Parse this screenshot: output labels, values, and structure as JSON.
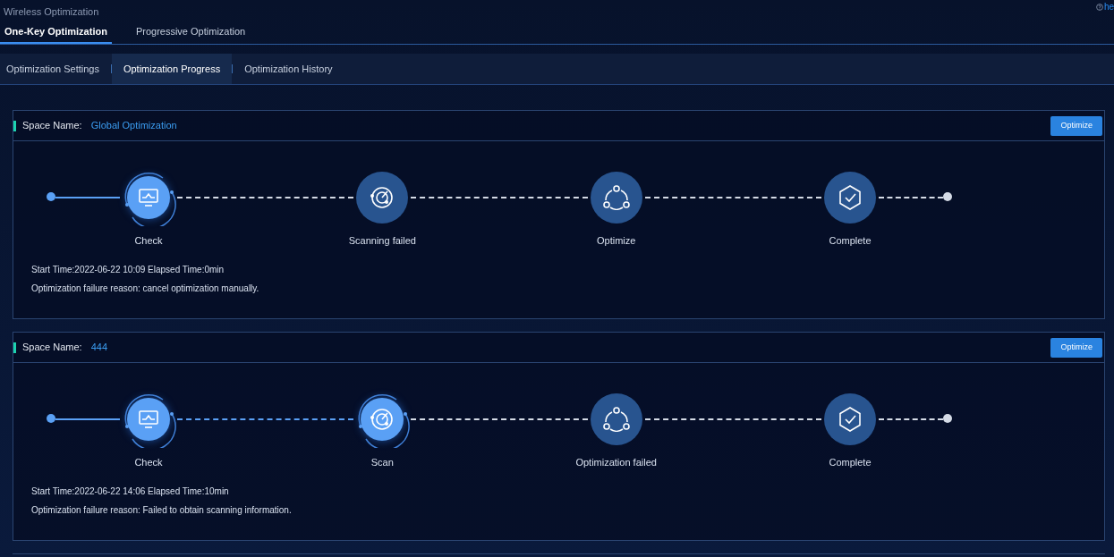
{
  "header": {
    "title": "Wireless Optimization",
    "help_link": "he"
  },
  "tabs": [
    {
      "label": "One-Key Optimization",
      "selected": true
    },
    {
      "label": "Progressive Optimization",
      "selected": false
    }
  ],
  "subtabs": [
    {
      "label": "Optimization Settings",
      "selected": false
    },
    {
      "label": "Optimization Progress",
      "selected": true
    },
    {
      "label": "Optimization History",
      "selected": false
    }
  ],
  "cards": [
    {
      "space_label": "Space Name:",
      "space_name": "Global Optimization",
      "button": "Optimize",
      "steps": [
        {
          "kind": "check",
          "label": "Check",
          "done": true
        },
        {
          "kind": "scan",
          "label": "Scanning failed",
          "done": false
        },
        {
          "kind": "optimize",
          "label": "Optimize",
          "done": false
        },
        {
          "kind": "complete",
          "label": "Complete",
          "done": false
        }
      ],
      "start_info": "Start Time:2022-06-22 10:09 Elapsed Time:0min",
      "failure_reason": "Optimization failure reason: cancel optimization manually."
    },
    {
      "space_label": "Space Name:",
      "space_name": "444",
      "button": "Optimize",
      "steps": [
        {
          "kind": "check",
          "label": "Check",
          "done": true
        },
        {
          "kind": "scan",
          "label": "Scan",
          "done": true
        },
        {
          "kind": "optimize",
          "label": "Optimization failed",
          "done": false
        },
        {
          "kind": "complete",
          "label": "Complete",
          "done": false
        }
      ],
      "start_info": "Start Time:2022-06-22 14:06 Elapsed Time:10min",
      "failure_reason": "Optimization failure reason: Failed to obtain scanning information."
    }
  ]
}
